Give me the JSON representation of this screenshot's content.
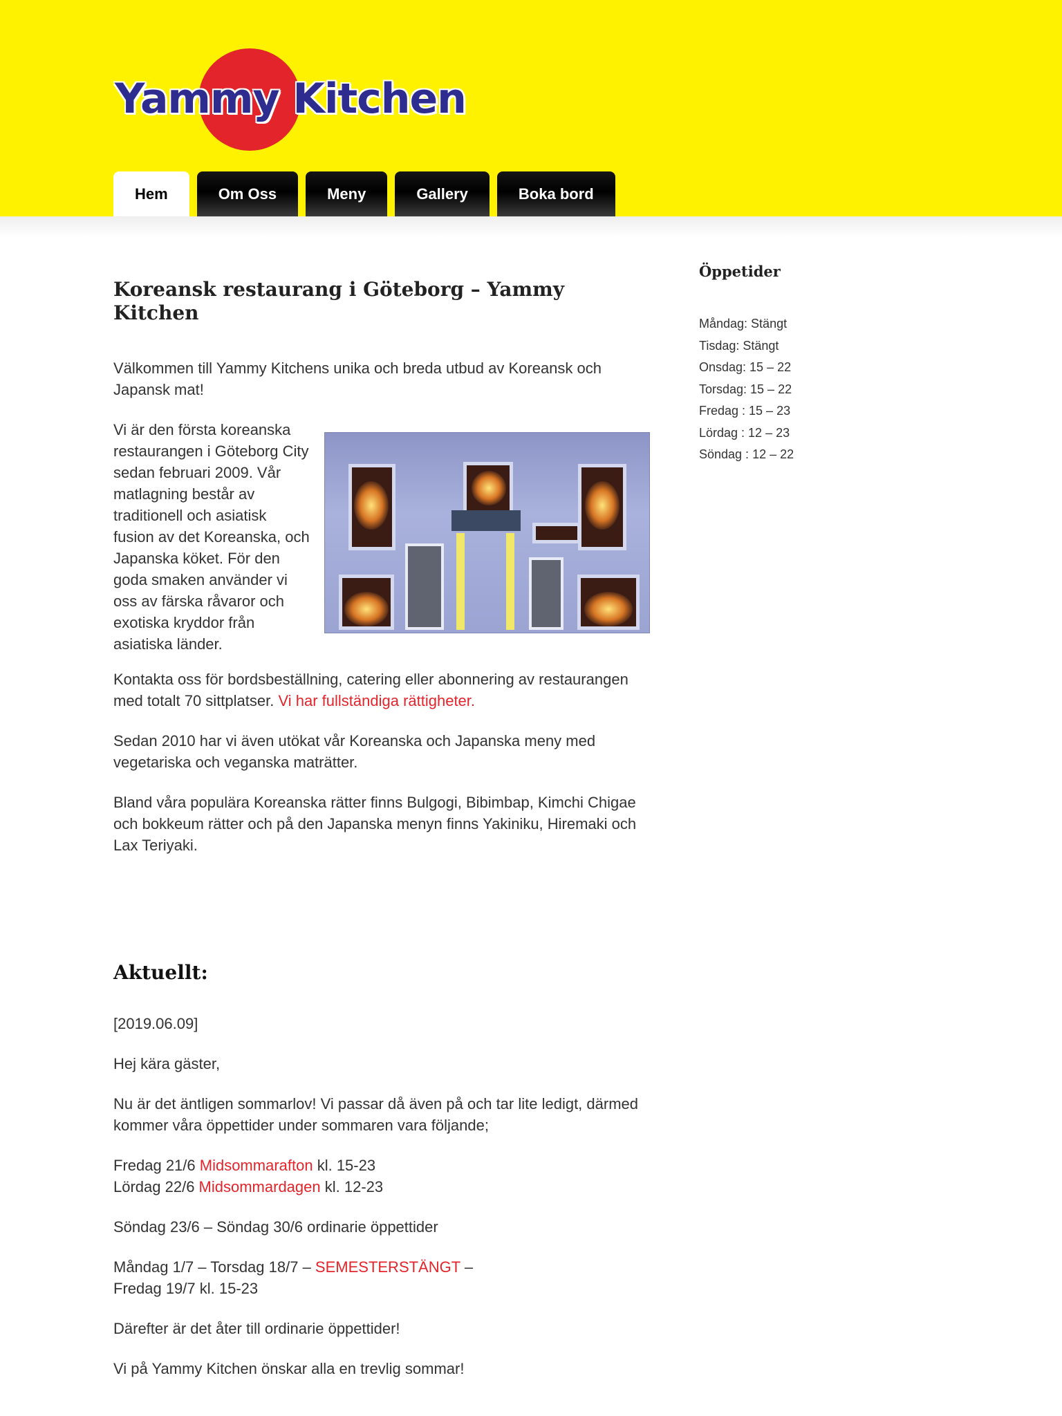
{
  "logo": {
    "text": "Yammy Kitchen"
  },
  "nav": [
    {
      "label": "Hem",
      "active": true
    },
    {
      "label": "Om Oss",
      "active": false
    },
    {
      "label": "Meny",
      "active": false
    },
    {
      "label": "Gallery",
      "active": false
    },
    {
      "label": "Boka bord",
      "active": false
    }
  ],
  "colors": {
    "header_bg": "#fff200",
    "accent_red": "#e3242b",
    "logo_blue": "#2e2c8f"
  },
  "main": {
    "title": "Koreansk restaurang i Göteborg – Yammy Kitchen",
    "intro": "Välkommen till Yammy Kitchens unika och breda utbud av Koreansk och Japansk mat!",
    "float_text": "Vi är den första koreanska restaurangen i Göteborg City sedan februari 2009. Vår matlagning består av traditionell och asiatisk fusion av det Koreanska, och Japanska köket. För den goda smaken använder vi oss av färska råvaror och exotiska kryddor från asiatiska länder.",
    "contact_text": "Kontakta oss för bordsbeställning, catering eller abonnering av restaurangen med totalt 70 sittplatser. ",
    "contact_link": "Vi har fullständiga rättigheter.",
    "vegan_text": "Sedan 2010 har vi även utökat vår Koreanska och Japanska meny med vegetariska och veganska maträtter.",
    "popular_text": "Bland våra populära Koreanska rätter finns Bulgogi, Bibimbap, Kimchi Chigae och bokkeum rätter och på den Japanska menyn finns Yakiniku, Hiremaki och Lax Teriyaki."
  },
  "aktuellt": {
    "title": "Aktuellt:",
    "date": "[2019.06.09]",
    "greeting": "Hej kära gäster,",
    "summer": "Nu är det äntligen sommarlov! Vi passar då även på och tar lite ledigt, därmed kommer våra öppettider under sommaren vara följande;",
    "line1_pre": "Fredag 21/6 ",
    "line1_link": "Midsommarafton",
    "line1_post": " kl. 15-23",
    "line2_pre": "Lördag 22/6 ",
    "line2_link": "Midsommardagen",
    "line2_post": " kl. 12-23",
    "ordinary": "Söndag 23/6 – Söndag 30/6 ordinarie öppettider",
    "closed_pre": "Måndag 1/7 – Torsdag 18/7 – ",
    "closed_link": "SEMESTERSTÄNGT",
    "closed_post": " –",
    "reopen": "Fredag 19/7 kl. 15-23",
    "after": "Därefter är det åter till ordinarie öppettider!",
    "wish": "Vi på Yammy Kitchen önskar alla en trevlig sommar!"
  },
  "sidebar": {
    "title": "Öppetider",
    "hours": [
      "Måndag: Stängt",
      "Tisdag: Stängt",
      "Onsdag: 15 – 22",
      "Torsdag: 15 – 22",
      "Fredag : 15 – 23",
      "Lördag : 12 – 23",
      "Söndag : 12 – 22"
    ]
  }
}
